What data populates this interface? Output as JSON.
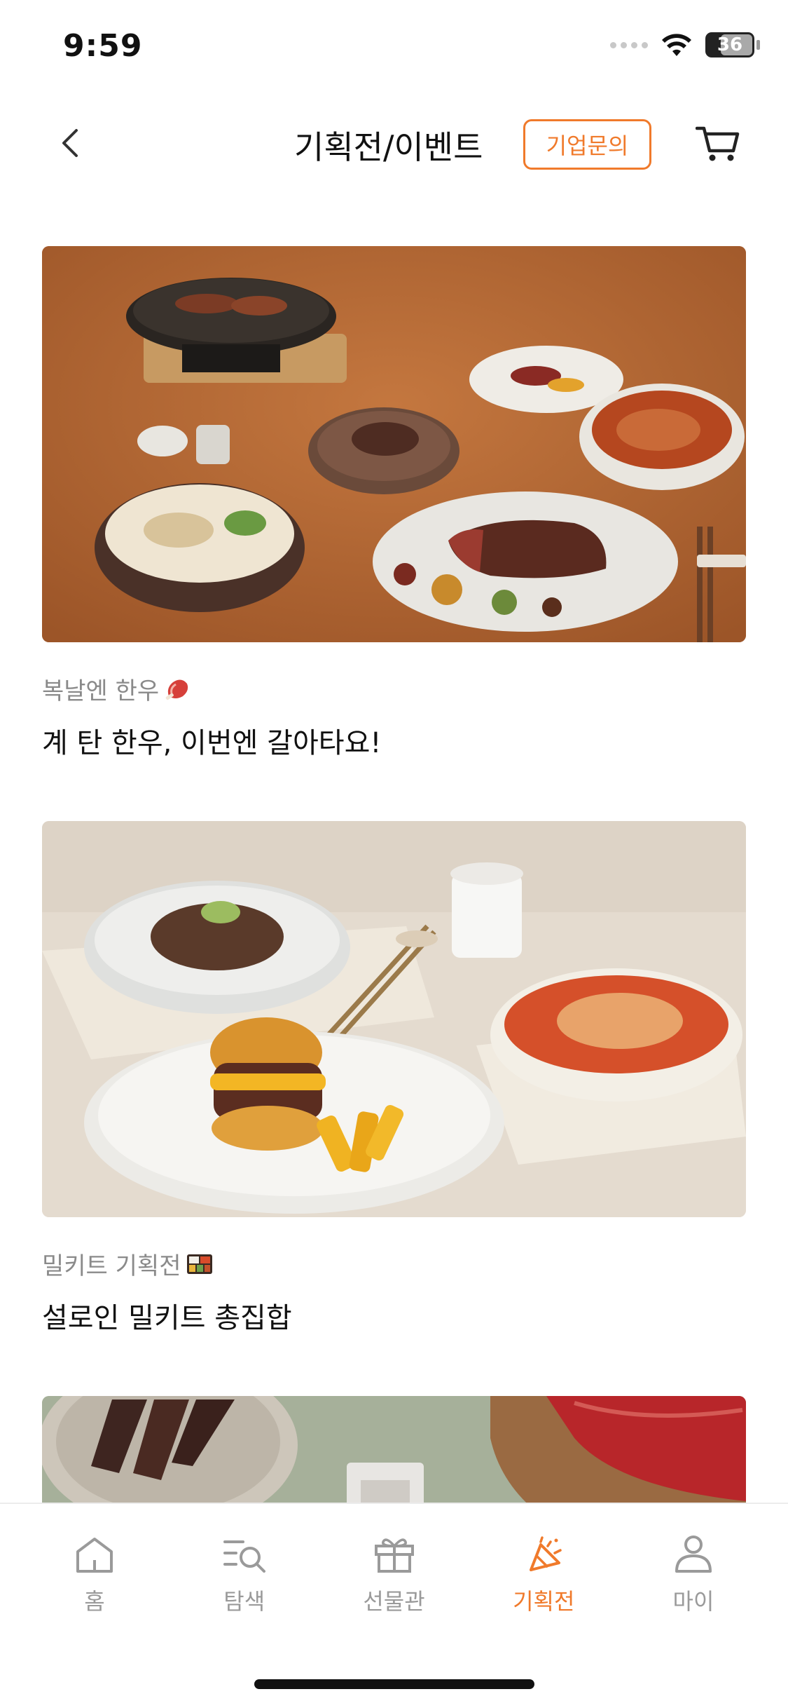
{
  "status_bar": {
    "time": "9:59",
    "battery": "36"
  },
  "header": {
    "title": "기획전/이벤트",
    "biz_inquiry_label": "기업문의",
    "back_icon": "chevron-left-icon",
    "cart_icon": "cart-icon"
  },
  "events": [
    {
      "subtitle": "복날엔 한우",
      "subtitle_emoji": "meat-on-bone-icon",
      "title": "계 탄 한우, 이번엔 갈아타요!",
      "image_desc_colors": {
        "background": "#b8683a"
      }
    },
    {
      "subtitle": "밀키트 기획전",
      "subtitle_emoji": "bento-box-icon",
      "title": "설로인 밀키트 총집합",
      "image_desc_colors": {
        "background": "#e6dcd0"
      }
    },
    {
      "image_desc_colors": {
        "background": "#a9b39c"
      }
    }
  ],
  "bottom_nav": {
    "items": [
      {
        "label": "홈",
        "icon": "home-icon",
        "active": false
      },
      {
        "label": "탐색",
        "icon": "search-list-icon",
        "active": false
      },
      {
        "label": "선물관",
        "icon": "gift-icon",
        "active": false
      },
      {
        "label": "기획전",
        "icon": "party-popper-icon",
        "active": true
      },
      {
        "label": "마이",
        "icon": "person-icon",
        "active": false
      }
    ]
  },
  "colors": {
    "accent": "#f07a2b",
    "muted_text": "#8a8a8a",
    "nav_inactive": "#9a9a9a"
  }
}
